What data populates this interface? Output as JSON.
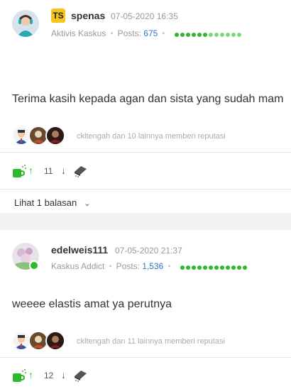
{
  "posts": [
    {
      "badge": "TS",
      "username": "spenas",
      "time": "07-05-2020 16:35",
      "rank": "Aktivis Kaskus",
      "posts_label": "Posts:",
      "posts_count": "675",
      "content": "Terima kasih kepada agan dan sista yang sudah mam",
      "reputation_text": "ckltengah dan 10 lainnya memberi reputasi",
      "vote_count": "11",
      "reply_label": "Lihat 1 balasan"
    },
    {
      "username": "edelweis111",
      "time": "07-05-2020 21:37",
      "rank": "Kaskus Addict",
      "posts_label": "Posts:",
      "posts_count": "1,536",
      "content": "weeee elastis amat ya perutnya",
      "reputation_text": "ckltengah dan 11 lainnya memberi reputasi",
      "vote_count": "12"
    }
  ],
  "colors": {
    "accent_green": "#2eb82e",
    "link_blue": "#2d76c9",
    "badge_yellow": "#f5c518"
  },
  "icons": [
    "avatar",
    "ts-badge",
    "reputation-bar",
    "cendol-cup-icon",
    "upvote-arrow-icon",
    "downvote-arrow-icon",
    "bata-brick-icon",
    "chevron-down-icon"
  ]
}
